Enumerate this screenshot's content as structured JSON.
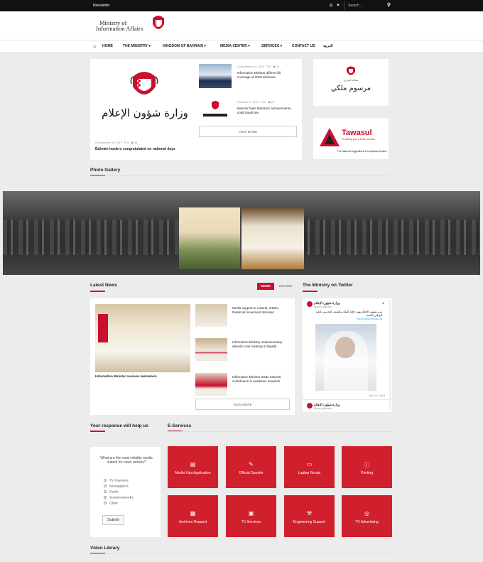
{
  "topbar": {
    "newsletter": "Newsletter",
    "search_placeholder": "Search ..."
  },
  "header": {
    "logo_line1": "Ministry of",
    "logo_line2": "Information Affairs"
  },
  "nav": {
    "items": [
      "HOME",
      "THE MINISTRY",
      "KINGDOM OF BAHRAIN",
      "MEDIA CENTER",
      "SERVICES",
      "CONTACT US",
      "العربية"
    ]
  },
  "featured": {
    "date": "December 14, 2017",
    "comments": "0",
    "views": "28",
    "title": "Bahrain leaders congratulated on national days",
    "calligraphy": "وزارة شؤون الإعلام"
  },
  "side_news": [
    {
      "date": "November 23, 2018",
      "comments": "0",
      "views": "74",
      "title": "Information Minister affirms full coverage of 2018 elections"
    },
    {
      "date": "March 17, 2017",
      "comments": "0",
      "views": "21",
      "title": "Minister hails Bahrain's achievements, solid Saudi ties"
    }
  ],
  "view_more": "VIEW MORE",
  "banners": {
    "royal_decree": "مرسوم ملكي",
    "royal_decree_top": "مملكة البحرين",
    "tawasul": "Tawasul",
    "tawasul_tag": "Providing you a better service",
    "tawasul_sub": "The National Suggestions & Complaints System"
  },
  "photo_gallery": {
    "title": "Photo Gallery"
  },
  "latest_news": {
    "title": "Latest News",
    "tabs": [
      "NEWS",
      "DECREE"
    ],
    "main_title": "Information Minister receives lawmakers",
    "items": [
      "Media support to cultural, artistic, theatrical movement stressed",
      "Information Ministry undersecretary attends Arab meeting in Riyadh",
      "Information Minister leads national contribution in academic research"
    ],
    "view_more": "VIEW MORE"
  },
  "twitter": {
    "title": "The Ministry on Twitter",
    "account": "وزارة شؤون الإعلام",
    "handle": "@moi_bahrain",
    "tweet": "وزير شؤون الإعلام يهنئ جلالة الملك والشعب البحريني بالعيد الوطني المجيد",
    "link": "bit.ly/2bmC9DH5L0A",
    "date": "Dec 15, 2018",
    "account2": "وزارة شؤون الإعلام",
    "handle2": "@moi_bahrain"
  },
  "poll": {
    "title": "Your response will help us",
    "question": "What are the most reliable media outlets for news articles?",
    "options": [
      "TV channels",
      "Newspapers",
      "Radio",
      "Social networks",
      "Other"
    ],
    "submit": "Submit"
  },
  "eservices": {
    "title": "E-Services",
    "items": [
      {
        "label": "Media Visa Application",
        "icon": "▤"
      },
      {
        "label": "Official Gazette",
        "icon": "✎"
      },
      {
        "label": "Laptop Rental",
        "icon": "▭"
      },
      {
        "label": "Printing",
        "icon": "ⓘ"
      },
      {
        "label": "Archives Request",
        "icon": "▦"
      },
      {
        "label": "TV Services",
        "icon": "▣"
      },
      {
        "label": "Engineering Support",
        "icon": "⚒"
      },
      {
        "label": "TV Advertising",
        "icon": "◎"
      }
    ]
  },
  "video_library": {
    "title": "Video Library"
  },
  "colors": {
    "accent": "#c8102e",
    "topbar": "#111111"
  }
}
